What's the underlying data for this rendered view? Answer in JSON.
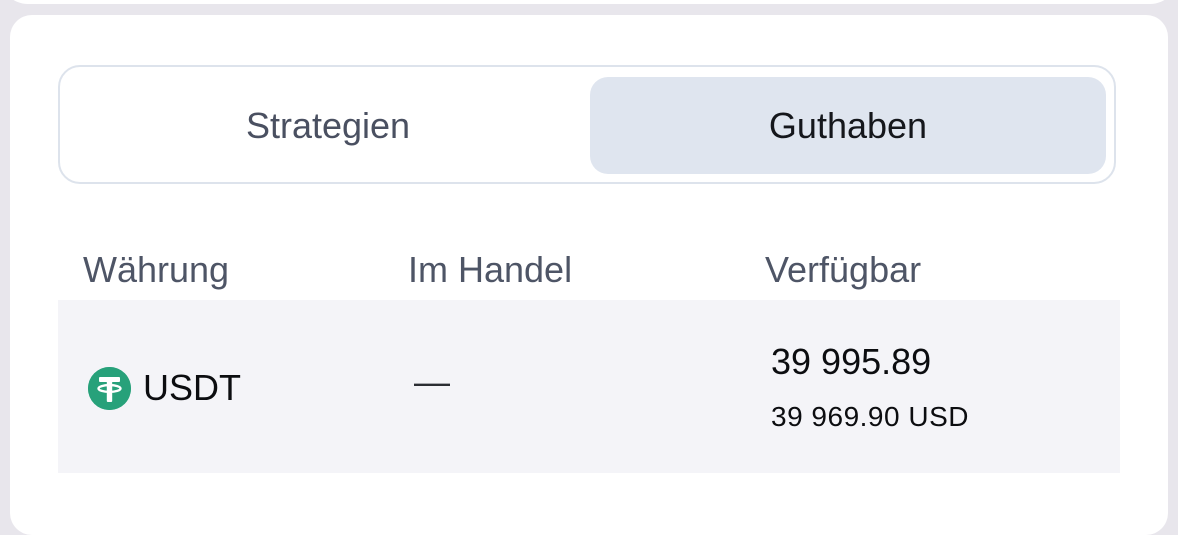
{
  "tabs": [
    {
      "label": "Strategien",
      "active": false
    },
    {
      "label": "Guthaben",
      "active": true
    }
  ],
  "table": {
    "headers": [
      "Währung",
      "Im Handel",
      "Verfügbar"
    ],
    "rows": [
      {
        "icon": "tether-icon",
        "currency": "USDT",
        "in_trade": "—",
        "available": "39 995.89",
        "available_usd": "39 969.90 USD"
      }
    ]
  },
  "colors": {
    "background": "#e8e6ec",
    "active_tab": "#dfe5ef",
    "row_background": "#f4f4f8",
    "tether_green": "#27a17a"
  }
}
